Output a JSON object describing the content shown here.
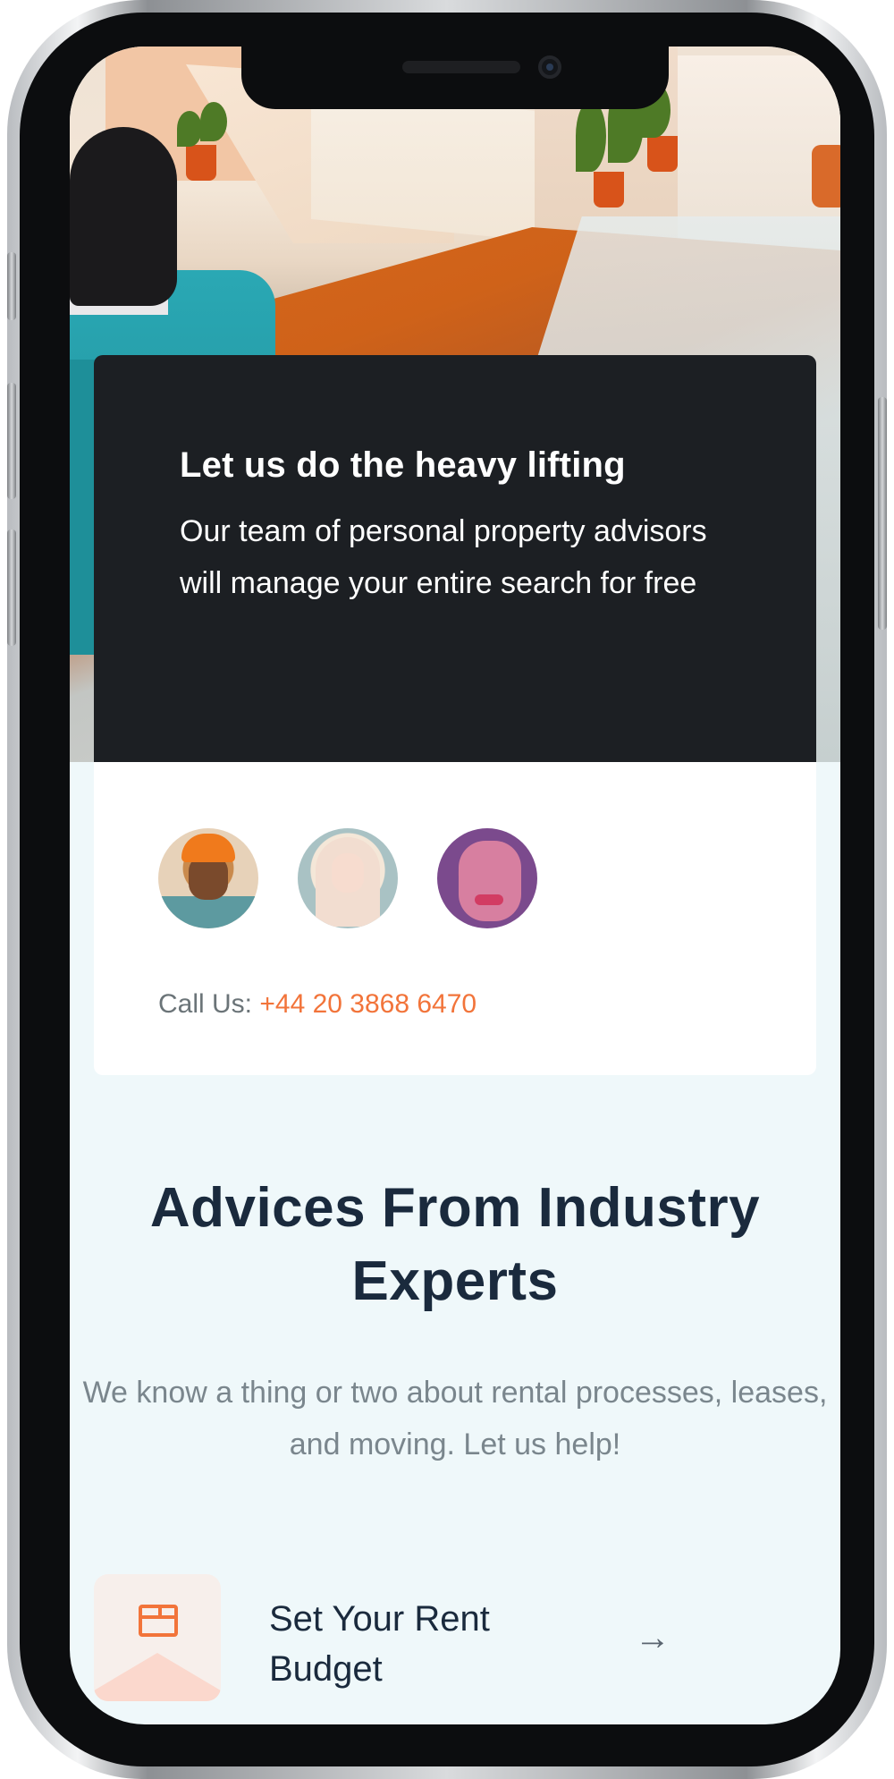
{
  "hero_card": {
    "title": "Let us do the heavy lifting",
    "text": "Our team of personal property advisors will manage your entire search for free"
  },
  "contact": {
    "call_label": "Call Us:",
    "phone_number": "+44 20 3868 6470",
    "advisors": [
      {
        "icon": "advisor-avatar-1"
      },
      {
        "icon": "advisor-avatar-2"
      },
      {
        "icon": "advisor-avatar-3"
      }
    ]
  },
  "advice": {
    "title": "Advices From Industry Experts",
    "subtitle": "We know a thing or two about rental processes, leases, and moving. Let us help!"
  },
  "cards": [
    {
      "label": "Set Your Rent Budget",
      "icon": "wallet-icon",
      "arrow_icon": "arrow-right-icon",
      "arrow_glyph": "→"
    }
  ],
  "colors": {
    "accent": "#f2743a",
    "dark_card": "#1c1f23",
    "heading": "#1a2a3d",
    "muted": "#7a868d",
    "page_bg": "#eff8fa"
  }
}
